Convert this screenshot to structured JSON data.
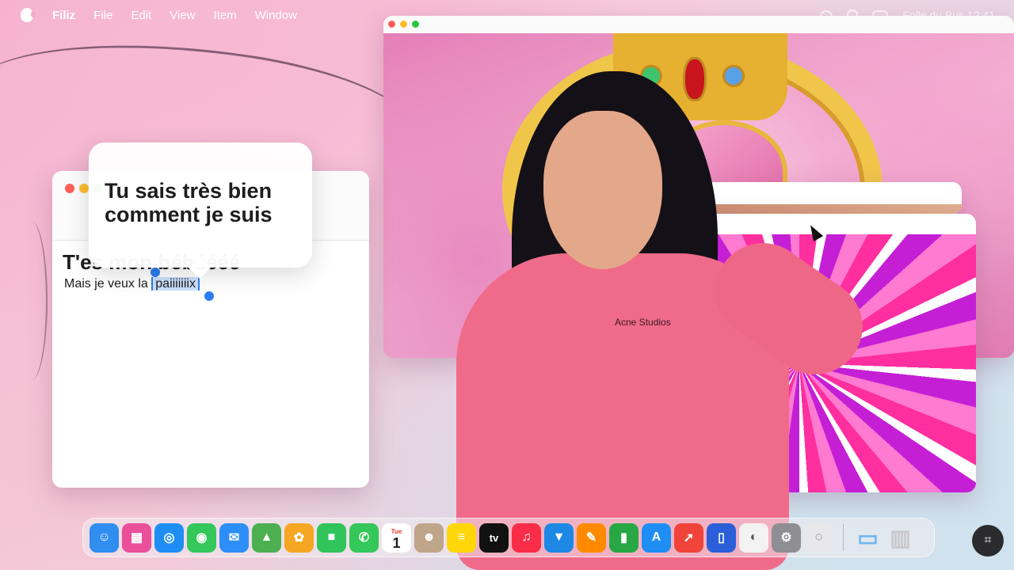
{
  "menubar": {
    "app_name": "Filiz",
    "items": [
      "File",
      "Edit",
      "View",
      "Item",
      "Window"
    ],
    "right_text": "Folle du Bus  12:41"
  },
  "notes": {
    "title": "T'es mon bébéééé",
    "body_prefix": "Mais je veux la ",
    "selected_word": "paiiiiiiix"
  },
  "popover": {
    "line1": "Tu sais très bien",
    "line2": "comment je suis"
  },
  "person": {
    "shirt_logo": "Acne Studios"
  },
  "dock": {
    "apps": [
      {
        "name": "finder",
        "glyph": "☺",
        "color": "#2f8ef0"
      },
      {
        "name": "launchpad",
        "glyph": "▦",
        "color": "#e94f9a"
      },
      {
        "name": "safari",
        "glyph": "◎",
        "color": "#1e8ef5"
      },
      {
        "name": "messages",
        "glyph": "◉",
        "color": "#34c759"
      },
      {
        "name": "mail",
        "glyph": "✉",
        "color": "#2e8ef7"
      },
      {
        "name": "maps",
        "glyph": "▲",
        "color": "#4caf50"
      },
      {
        "name": "photos",
        "glyph": "✿",
        "color": "#f5a623"
      },
      {
        "name": "facetime",
        "glyph": "■",
        "color": "#30c45a"
      },
      {
        "name": "phone",
        "glyph": "✆",
        "color": "#34c759"
      },
      {
        "name": "calendar",
        "glyph": "1",
        "color": "#ffffff"
      },
      {
        "name": "contacts",
        "glyph": "☻",
        "color": "#bfa58a"
      },
      {
        "name": "notes",
        "glyph": "≡",
        "color": "#ffd60a"
      },
      {
        "name": "tv",
        "glyph": "tv",
        "color": "#111111"
      },
      {
        "name": "music",
        "glyph": "♫",
        "color": "#fa2d48"
      },
      {
        "name": "keynote",
        "glyph": "▼",
        "color": "#1e88e5"
      },
      {
        "name": "pages",
        "glyph": "✎",
        "color": "#ff8a00"
      },
      {
        "name": "numbers",
        "glyph": "▮",
        "color": "#28a745"
      },
      {
        "name": "app-store",
        "glyph": "A",
        "color": "#1e8ef5"
      },
      {
        "name": "rocket",
        "glyph": "➚",
        "color": "#f0443a"
      },
      {
        "name": "simulator",
        "glyph": "▯",
        "color": "#2b5fd9"
      },
      {
        "name": "disk-utility",
        "glyph": "◐",
        "color": "#f2f2f2"
      },
      {
        "name": "system-settings",
        "glyph": "⚙",
        "color": "#8e8e93"
      },
      {
        "name": "blank-app",
        "glyph": "◌",
        "color": "#e8e8ea"
      }
    ],
    "folder": {
      "name": "folder",
      "glyph": "▭",
      "color": "#6cb6f5"
    },
    "trash": {
      "name": "trash",
      "glyph": "▥",
      "color": "#c7c7cc"
    },
    "calendar_day": "Tue"
  },
  "colors": {
    "accent": "#2a7ef0",
    "shirt": "#f06b8a"
  }
}
